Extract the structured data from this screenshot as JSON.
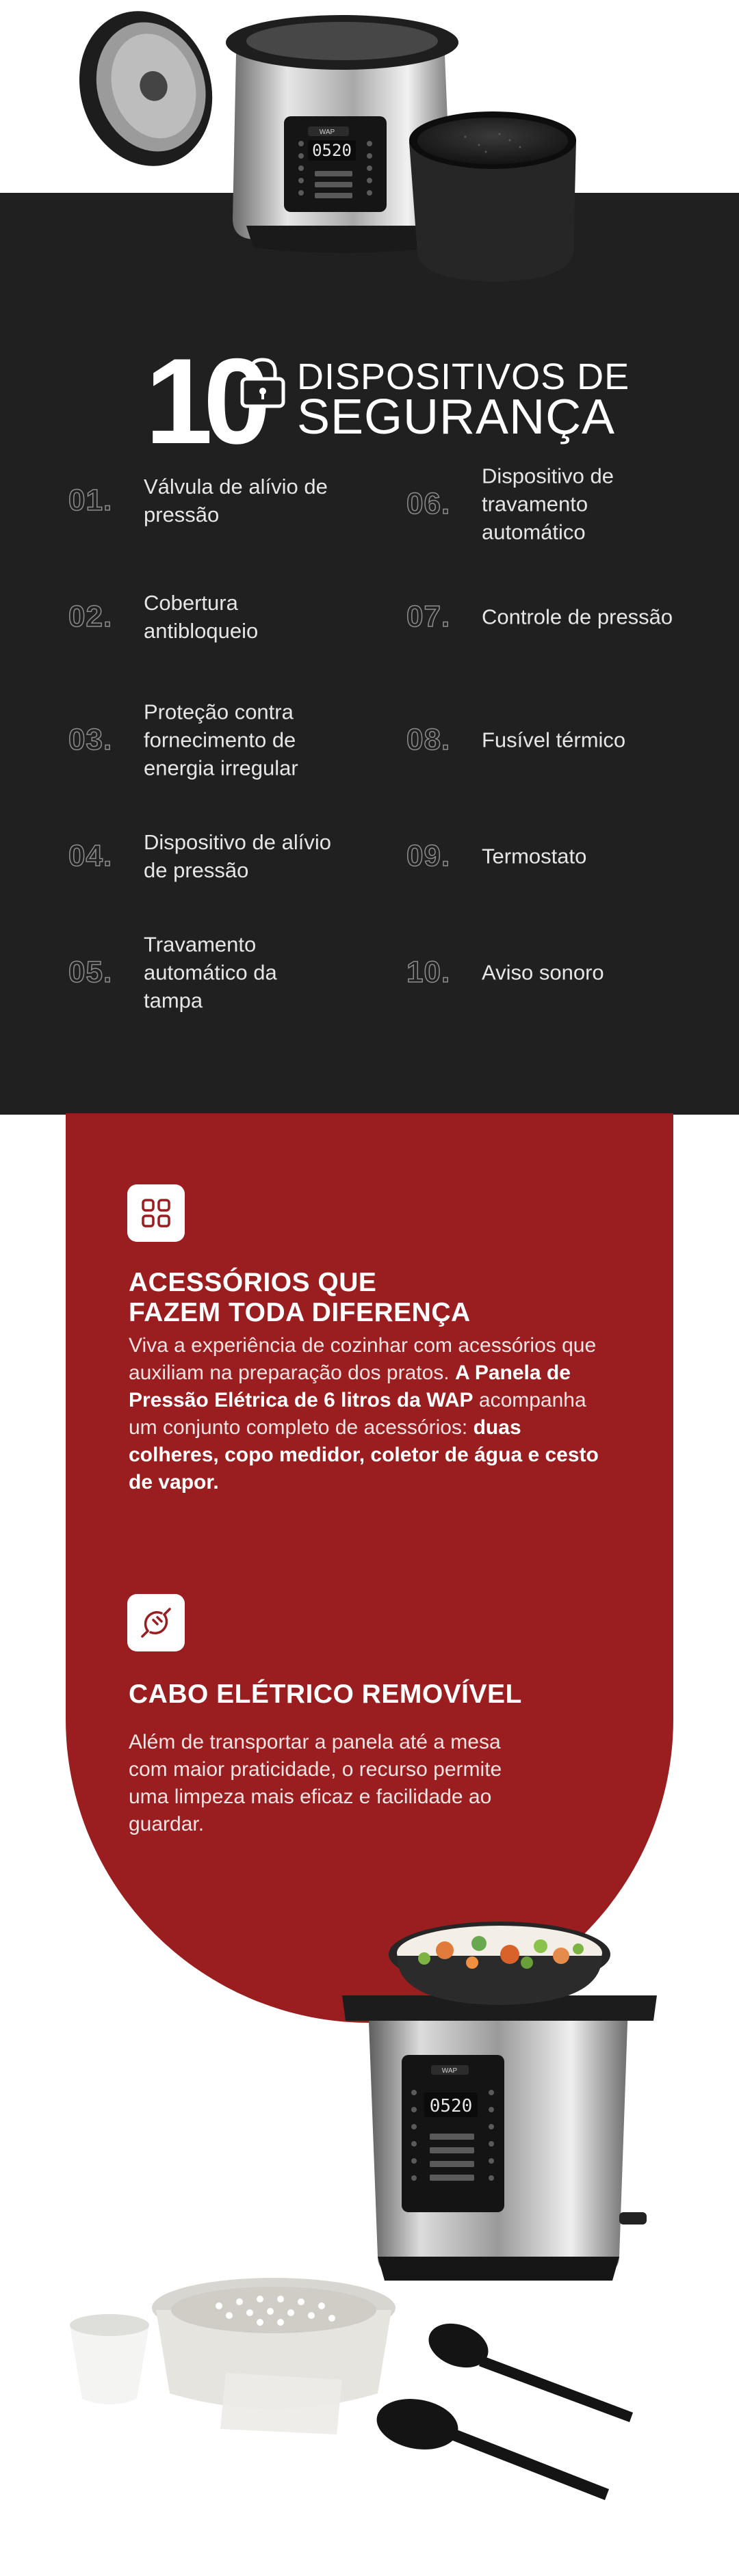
{
  "safety": {
    "count": "10",
    "title_line1": "DISPOSITIVOS DE",
    "title_line2": "SEGURANÇA",
    "items": [
      {
        "num": "01.",
        "text": "Válvula de alívio de pressão"
      },
      {
        "num": "02.",
        "text": "Cobertura antibloqueio"
      },
      {
        "num": "03.",
        "text": "Proteção contra fornecimento de energia irregular"
      },
      {
        "num": "04.",
        "text": "Dispositivo de alívio de pressão"
      },
      {
        "num": "05.",
        "text": "Travamento automático da tampa"
      },
      {
        "num": "06.",
        "text": "Dispositivo de travamento automático"
      },
      {
        "num": "07.",
        "text": "Controle de pressão"
      },
      {
        "num": "08.",
        "text": "Fusível térmico"
      },
      {
        "num": "09.",
        "text": "Termostato"
      },
      {
        "num": "10.",
        "text": "Aviso sonoro"
      }
    ]
  },
  "accessories": {
    "icon": "grid-icon",
    "title_line1": "ACESSÓRIOS QUE",
    "title_line2": "FAZEM TODA DIFERENÇA",
    "body_part1": "Viva a experiência de cozinhar com acessórios que auxiliam na preparação dos pratos. ",
    "body_bold1": "A Panela de Pressão Elétrica de 6 litros da WAP",
    "body_part2": " acompanha um conjunto completo de acessórios: ",
    "body_bold2": "duas colheres, copo medidor, coletor de água e cesto de vapor."
  },
  "cable": {
    "icon": "unplug-icon",
    "title": "CABO ELÉTRICO REMOVÍVEL",
    "body": "Além de transportar a panela até a mesa com maior praticidade, o recurso permite uma limpeza mais eficaz e facilidade ao guardar."
  },
  "product": {
    "brand": "WAP",
    "display": "0520"
  },
  "colors": {
    "dark_bg": "#202020",
    "red_bg": "#9a1d1f",
    "white": "#ffffff"
  }
}
